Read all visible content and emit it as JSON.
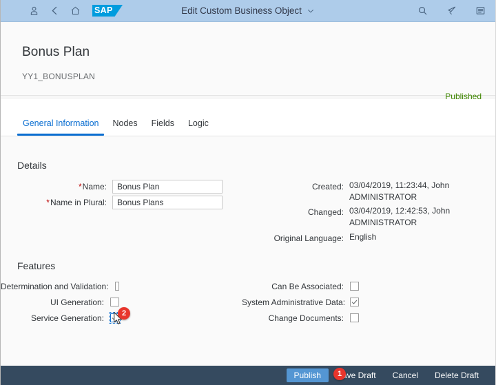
{
  "shell": {
    "title": "Edit Custom Business Object",
    "logo_text": "SAP",
    "icons": {
      "user": "user-icon",
      "back": "back-icon",
      "home": "home-icon",
      "search": "search-icon",
      "notifications": "megaphone-icon",
      "overflow": "list-icon",
      "title_chevron": "chevron-down-icon"
    }
  },
  "object_header": {
    "title": "Bonus Plan",
    "subtitle": "YY1_BONUSPLAN",
    "status": "Published",
    "status_color": "#3f8600"
  },
  "tabs": [
    {
      "label": "General Information",
      "active": true
    },
    {
      "label": "Nodes",
      "active": false
    },
    {
      "label": "Fields",
      "active": false
    },
    {
      "label": "Logic",
      "active": false
    }
  ],
  "details": {
    "heading": "Details",
    "fields": [
      {
        "label": "Name:",
        "required": true,
        "value": "Bonus Plan"
      },
      {
        "label": "Name in Plural:",
        "required": true,
        "value": "Bonus Plans"
      }
    ],
    "info": [
      {
        "label": "Created:",
        "value": "03/04/2019, 11:23:44, John ADMINISTRATOR"
      },
      {
        "label": "Changed:",
        "value": "03/04/2019, 12:42:53, John ADMINISTRATOR"
      },
      {
        "label": "Original Language:",
        "value": "English"
      }
    ]
  },
  "features": {
    "heading": "Features",
    "left": [
      {
        "label": "Determination and Validation:",
        "checked": false
      },
      {
        "label": "UI Generation:",
        "checked": false
      },
      {
        "label": "Service Generation:",
        "checked": true
      }
    ],
    "right": [
      {
        "label": "Can Be Associated:",
        "checked": false
      },
      {
        "label": "System Administrative Data:",
        "checked": true
      },
      {
        "label": "Change Documents:",
        "checked": false
      }
    ]
  },
  "footer": {
    "publish": "Publish",
    "save_draft": "Save Draft",
    "cancel": "Cancel",
    "delete_draft": "Delete Draft"
  },
  "annotations": [
    {
      "number": "1",
      "target": "publish-button"
    },
    {
      "number": "2",
      "target": "service-generation-checkbox"
    }
  ],
  "colors": {
    "shell_bar": "#aeccea",
    "accent": "#0a6ed1",
    "footer_bar": "#354a5f",
    "emphasized_button": "#5496d3",
    "badge": "#e8352c",
    "required": "#bb0000"
  }
}
